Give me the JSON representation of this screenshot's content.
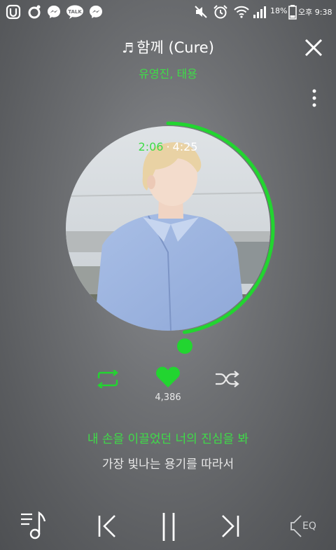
{
  "status_bar": {
    "battery": "18%",
    "time": "오후 9:38",
    "left_icons": [
      "swing-icon",
      "o-icon",
      "messenger-icon",
      "kakaotalk-icon",
      "messenger-icon"
    ],
    "right_icons": [
      "mute-icon",
      "alarm-icon",
      "wifi-icon",
      "signal-icon",
      "battery-icon"
    ]
  },
  "player": {
    "note_glyph": "♬",
    "title": "함께 (Cure)",
    "artist": "유영진, 태용",
    "current_time": "2:06",
    "separator": "·",
    "total_time": "4:25",
    "progress": 0.475,
    "like_count": "4,386",
    "liked": true
  },
  "lyrics": {
    "current": "내 손을 이끌었던 너의 진심을 봐",
    "next": "가장 빛나는 용기를 따라서"
  },
  "bottom_bar": {
    "eq_label": "EQ"
  },
  "colors": {
    "accent": "#22d530",
    "accent_text": "#3fdc48",
    "background": "#6e7073"
  }
}
